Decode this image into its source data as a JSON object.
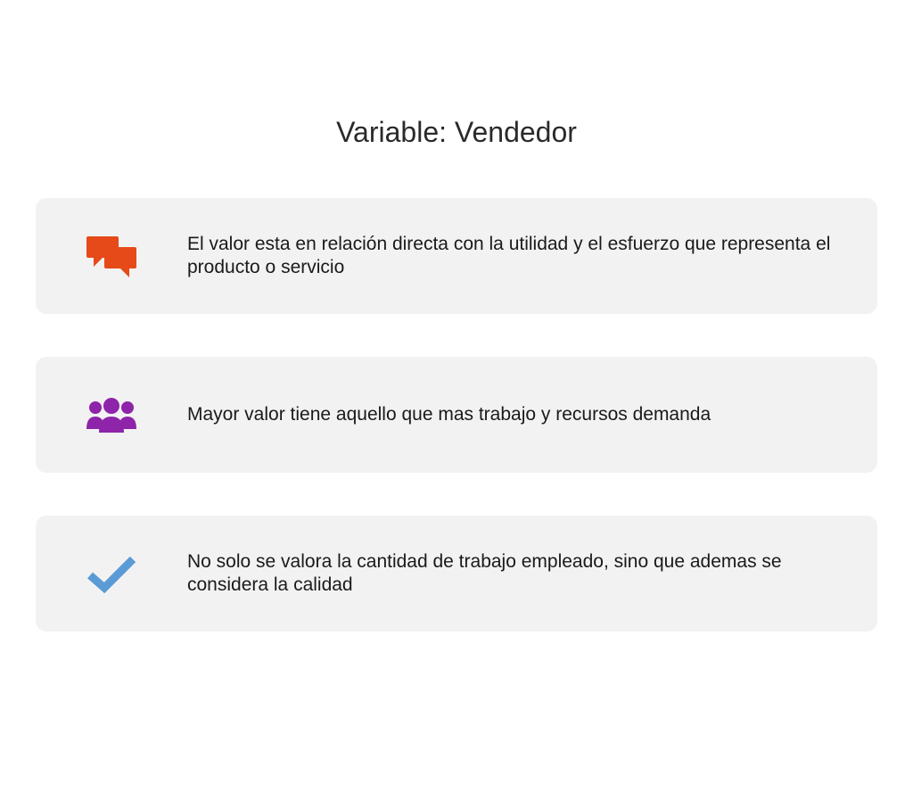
{
  "title": "Variable: Vendedor",
  "rows": [
    {
      "icon": "chat-icon",
      "color": "#E64A19",
      "text": "El valor esta en relación directa con la utilidad y el esfuerzo que representa el producto o servicio"
    },
    {
      "icon": "team-icon",
      "color": "#8E24AA",
      "text": "Mayor valor tiene aquello que mas trabajo y recursos demanda"
    },
    {
      "icon": "check-icon",
      "color": "#5B9BD5",
      "text": "No solo se valora la cantidad de trabajo empleado, sino que ademas se considera la calidad"
    }
  ]
}
